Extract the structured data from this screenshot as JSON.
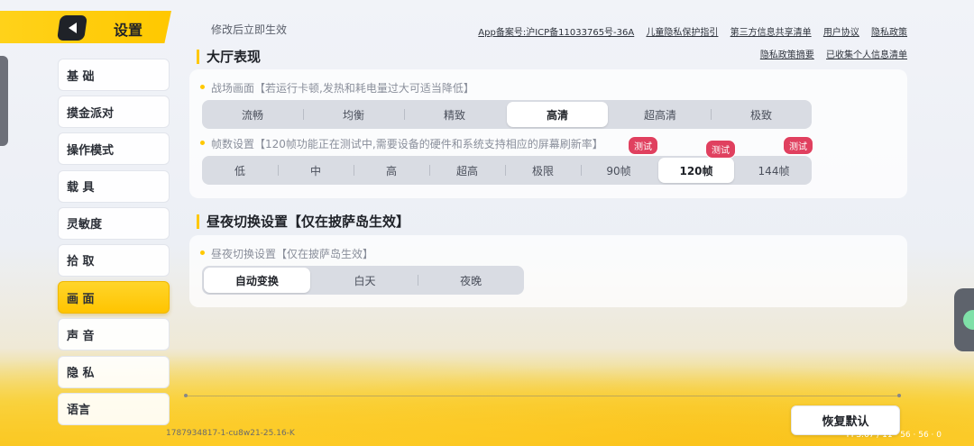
{
  "header": {
    "title": "设置"
  },
  "sidebar": {
    "items": [
      {
        "label": "基 础"
      },
      {
        "label": "摸金派对"
      },
      {
        "label": "操作模式"
      },
      {
        "label": "载 具"
      },
      {
        "label": "灵敏度"
      },
      {
        "label": "拾 取"
      },
      {
        "label": "画 面",
        "active": true
      },
      {
        "label": "声 音"
      },
      {
        "label": "隐 私"
      },
      {
        "label": "语言"
      }
    ]
  },
  "top": {
    "note": "修改后立即生效",
    "links_row1": [
      "App备案号:沪ICP备11033765号-36A",
      "儿童隐私保护指引",
      "第三方信息共享清单",
      "用户协议",
      "隐私政策"
    ],
    "links_row2": [
      "隐私政策摘要",
      "已收集个人信息清单"
    ]
  },
  "lobby": {
    "title": "大厅表现",
    "battle": {
      "label": "战场画面【若运行卡顿,发热和耗电量过大可适当降低】",
      "options": [
        "流畅",
        "均衡",
        "精致",
        "高清",
        "超高清",
        "极致"
      ],
      "selected": "高清"
    },
    "fps": {
      "label": "帧数设置【120帧功能正在测试中,需要设备的硬件和系统支持相应的屏幕刷新率】",
      "options": [
        "低",
        "中",
        "高",
        "超高",
        "极限",
        "90帧",
        "120帧",
        "144帧"
      ],
      "selected": "120帧",
      "badge": "测试"
    }
  },
  "daynight": {
    "title": "昼夜切换设置【仅在披萨岛生效】",
    "label": "昼夜切换设置【仅在披萨岛生效】",
    "options": [
      "自动变换",
      "白天",
      "夜晚"
    ],
    "selected": "自动变换"
  },
  "footer": {
    "reset_label": "恢复默认",
    "build_id": "1787934817-1-cu8w21-25.16-K",
    "fps_readout": "FPS:67 / 11 · 56 · 56 · 0"
  },
  "colors": {
    "accent": "#ffc800",
    "badge": "#e0405f"
  }
}
